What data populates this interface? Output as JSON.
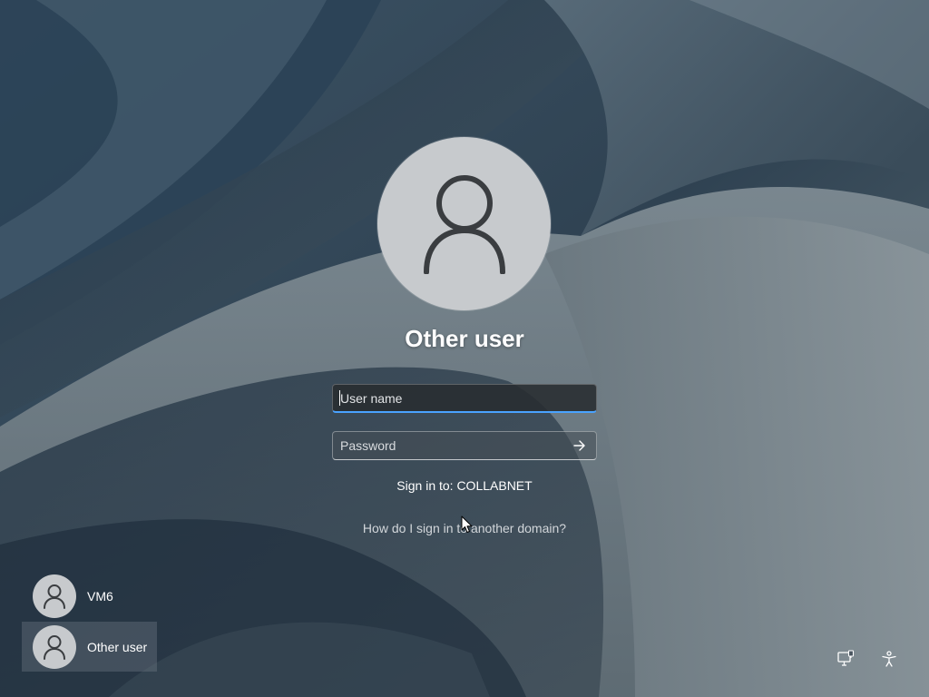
{
  "screen": {
    "current_user": {
      "name": "Other user"
    },
    "username_field": {
      "placeholder": "User name",
      "value": ""
    },
    "password_field": {
      "placeholder": "Password",
      "value": ""
    },
    "sign_in_to": "Sign in to: COLLABNET",
    "domain_help_link": "How do I sign in to another domain?",
    "user_list": [
      {
        "name": "VM6",
        "selected": false
      },
      {
        "name": "Other user",
        "selected": true
      }
    ],
    "bottom_right_icons": [
      "network-icon",
      "accessibility-icon"
    ],
    "colors": {
      "accent_focus": "#4aa3ff",
      "avatar_bg": "#c7cacd",
      "avatar_glyph": "#3a3d40"
    }
  }
}
